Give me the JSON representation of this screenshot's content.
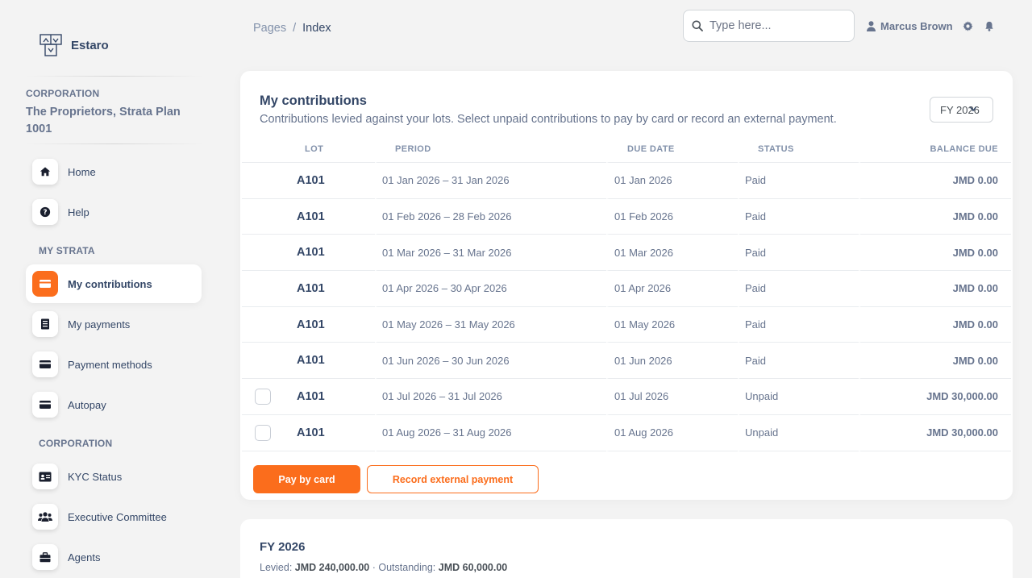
{
  "brand": {
    "name": "Estaro"
  },
  "sidebar": {
    "corp_label": "CORPORATION",
    "corp_name": "The Proprietors, Strata Plan 1001",
    "items_top": [
      {
        "label": "Home",
        "icon": "home-icon"
      },
      {
        "label": "Help",
        "icon": "help-icon"
      }
    ],
    "my_strata_label": "MY STRATA",
    "my_strata": [
      {
        "label": "My contributions",
        "icon": "card-icon",
        "active": true
      },
      {
        "label": "My payments",
        "icon": "receipt-icon"
      },
      {
        "label": "Payment methods",
        "icon": "card-icon"
      },
      {
        "label": "Autopay",
        "icon": "card-icon"
      }
    ],
    "corporation_label": "CORPORATION",
    "corporation": [
      {
        "label": "KYC Status",
        "icon": "id-card-icon"
      },
      {
        "label": "Executive Committee",
        "icon": "users-icon"
      },
      {
        "label": "Agents",
        "icon": "briefcase-icon"
      }
    ]
  },
  "header": {
    "breadcrumb_root": "Pages",
    "breadcrumb_sep": "/",
    "breadcrumb_current": "Index",
    "search_placeholder": "Type here...",
    "user_name": "Marcus Brown"
  },
  "contributions": {
    "title": "My contributions",
    "subtitle": "Contributions levied against your lots. Select unpaid contributions to pay by card or record an external payment.",
    "fy_select": "FY 2026",
    "columns": {
      "lot": "LOT",
      "period": "PERIOD",
      "due": "DUE DATE",
      "status": "STATUS",
      "balance": "BALANCE DUE"
    },
    "rows": [
      {
        "lot": "A101",
        "period": "01 Jan 2026 – 31 Jan 2026",
        "due": "01 Jan 2026",
        "status": "Paid",
        "balance": "JMD 0.00",
        "selectable": false
      },
      {
        "lot": "A101",
        "period": "01 Feb 2026 – 28 Feb 2026",
        "due": "01 Feb 2026",
        "status": "Paid",
        "balance": "JMD 0.00",
        "selectable": false
      },
      {
        "lot": "A101",
        "period": "01 Mar 2026 – 31 Mar 2026",
        "due": "01 Mar 2026",
        "status": "Paid",
        "balance": "JMD 0.00",
        "selectable": false
      },
      {
        "lot": "A101",
        "period": "01 Apr 2026 – 30 Apr 2026",
        "due": "01 Apr 2026",
        "status": "Paid",
        "balance": "JMD 0.00",
        "selectable": false
      },
      {
        "lot": "A101",
        "period": "01 May 2026 – 31 May 2026",
        "due": "01 May 2026",
        "status": "Paid",
        "balance": "JMD 0.00",
        "selectable": false
      },
      {
        "lot": "A101",
        "period": "01 Jun 2026 – 30 Jun 2026",
        "due": "01 Jun 2026",
        "status": "Paid",
        "balance": "JMD 0.00",
        "selectable": false
      },
      {
        "lot": "A101",
        "period": "01 Jul 2026 – 31 Jul 2026",
        "due": "01 Jul 2026",
        "status": "Unpaid",
        "balance": "JMD 30,000.00",
        "selectable": true
      },
      {
        "lot": "A101",
        "period": "01 Aug 2026 – 31 Aug 2026",
        "due": "01 Aug 2026",
        "status": "Unpaid",
        "balance": "JMD 30,000.00",
        "selectable": true
      }
    ],
    "pay_button": "Pay by card",
    "record_button": "Record external payment"
  },
  "summary": {
    "title": "FY 2026",
    "levied_label": "Levied:",
    "levied_value": "JMD 240,000.00",
    "sep": "·",
    "outstanding_label": "Outstanding:",
    "outstanding_value": "JMD 60,000.00"
  },
  "colors": {
    "accent": "#fb6d1c",
    "text": "#344767",
    "muted": "#67748e"
  }
}
